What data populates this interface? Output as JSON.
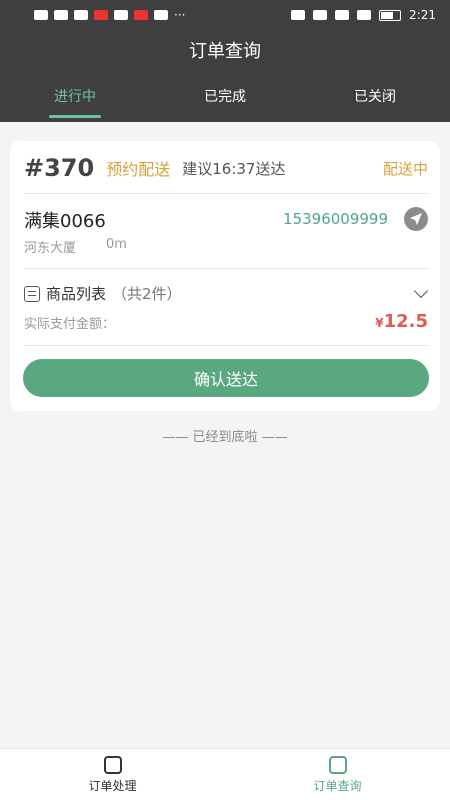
{
  "status_bar": {
    "left_icons": [
      "hd-icon",
      "signal-icon",
      "wifi-icon",
      "app-icon",
      "app-icon",
      "app-icon",
      "message-icon"
    ],
    "more": "···",
    "time": "2:21"
  },
  "header": {
    "title": "订单查询"
  },
  "tabs": [
    {
      "label": "进行中"
    },
    {
      "label": "已完成"
    },
    {
      "label": "已关闭"
    }
  ],
  "order": {
    "number": "#370",
    "type": "预约配送",
    "eta": "建议16:37送达",
    "status": "配送中",
    "customer": {
      "name": "满集0066",
      "phone": "15396009999",
      "address": "河东大厦",
      "distance": "0m"
    },
    "goods": {
      "title": "商品列表",
      "count": "（共2件）"
    },
    "paid_label": "实际支付金额：",
    "currency": "¥",
    "paid_amount": "12.5",
    "confirm_label": "确认送达"
  },
  "end_text": "—— 已经到底啦 ——",
  "bottom_nav": [
    {
      "label": "订单处理"
    },
    {
      "label": "订单查询"
    }
  ],
  "colors": {
    "header_bg": "#3f3f3f",
    "accent_green": "#5aa87f",
    "accent_gold": "#d6a23e",
    "price_red": "#e05b4f"
  }
}
